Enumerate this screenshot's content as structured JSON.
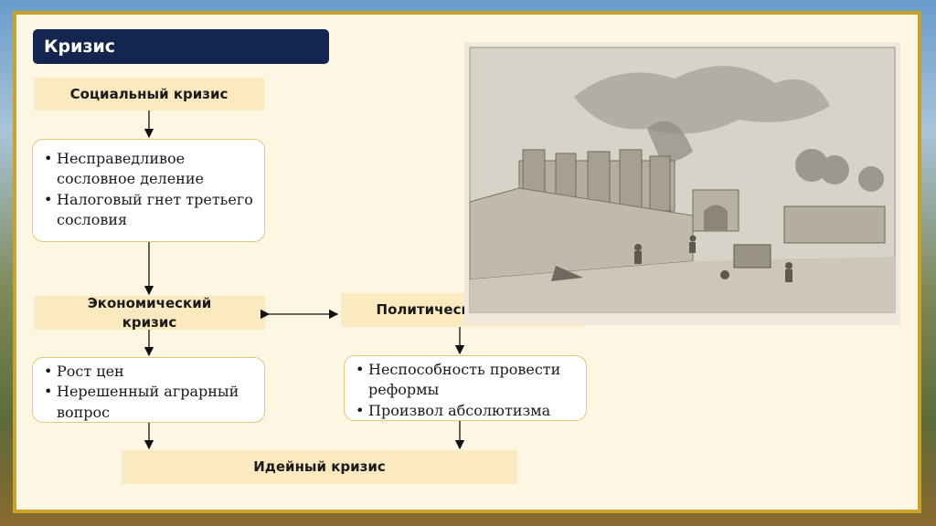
{
  "title": "Кризис",
  "social": {
    "label": "Социальный кризис",
    "items": [
      "Несправедливое сословное деление",
      "Налоговый гнет третьего сословия"
    ]
  },
  "economic": {
    "label": "Экономический кризис",
    "items": [
      "Рост цен",
      "Нерешенный аграрный вопрос"
    ]
  },
  "political": {
    "label": "Политический кризис",
    "items": [
      "Неспособность провести реформы",
      "Произвол абсолютизма"
    ]
  },
  "ideological": {
    "label": "Идейный кризис"
  },
  "colors": {
    "title_bg": "#14264f",
    "box_bg": "#fbeac0",
    "frame_border": "#c9a227",
    "slide_bg": "#fdf6e3"
  }
}
